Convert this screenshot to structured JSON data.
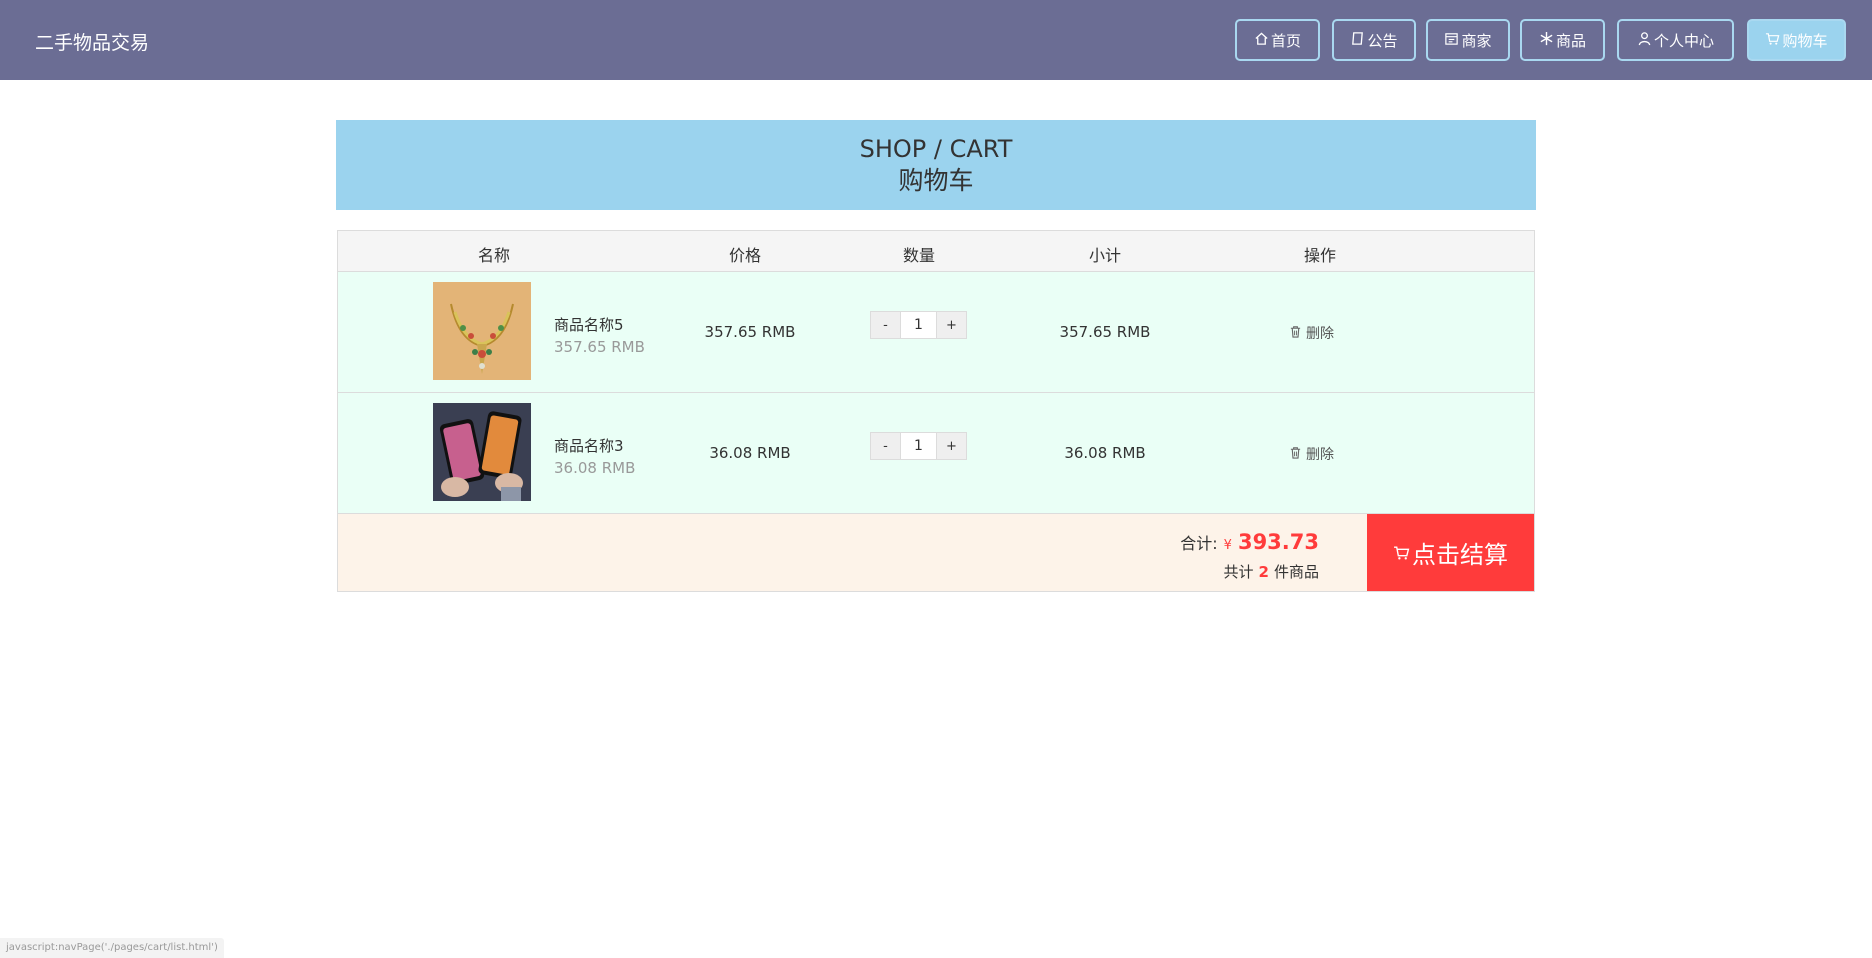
{
  "header": {
    "brand": "二手物品交易",
    "nav": [
      {
        "label": "首页",
        "icon": "home-icon",
        "active": false
      },
      {
        "label": "公告",
        "icon": "notice-icon",
        "active": false
      },
      {
        "label": "商家",
        "icon": "store-icon",
        "active": false
      },
      {
        "label": "商品",
        "icon": "snowflake-icon",
        "active": false
      },
      {
        "label": "个人中心",
        "icon": "user-icon",
        "active": false
      },
      {
        "label": "购物车",
        "icon": "cart-icon",
        "active": true
      }
    ]
  },
  "banner": {
    "title_en": "SHOP / CART",
    "title_cn": "购物车"
  },
  "table": {
    "headers": [
      "名称",
      "价格",
      "数量",
      "小计",
      "操作"
    ],
    "rows": [
      {
        "name": "商品名称5",
        "price_sub": "357.65 RMB",
        "price": "357.65 RMB",
        "minus": "-",
        "qty": "1",
        "plus": "+",
        "subtotal": "357.65 RMB",
        "action": "删除"
      },
      {
        "name": "商品名称3",
        "price_sub": "36.08 RMB",
        "price": "36.08 RMB",
        "minus": "-",
        "qty": "1",
        "plus": "+",
        "subtotal": "36.08 RMB",
        "action": "删除"
      }
    ]
  },
  "summary": {
    "total_label": "合计:",
    "currency": "¥",
    "total": "393.73",
    "count_prefix": "共计",
    "count": "2",
    "count_suffix": "件商品",
    "checkout_label": "点击结算"
  },
  "statusbar": {
    "text": "javascript:navPage('./pages/cart/list.html')"
  },
  "colors": {
    "header_bg": "#6b6d94",
    "accent_blue": "#9bd3ee",
    "row_bg": "#eafff6",
    "footer_bg": "#fdf3e9",
    "checkout_red": "#ff3b3b"
  }
}
